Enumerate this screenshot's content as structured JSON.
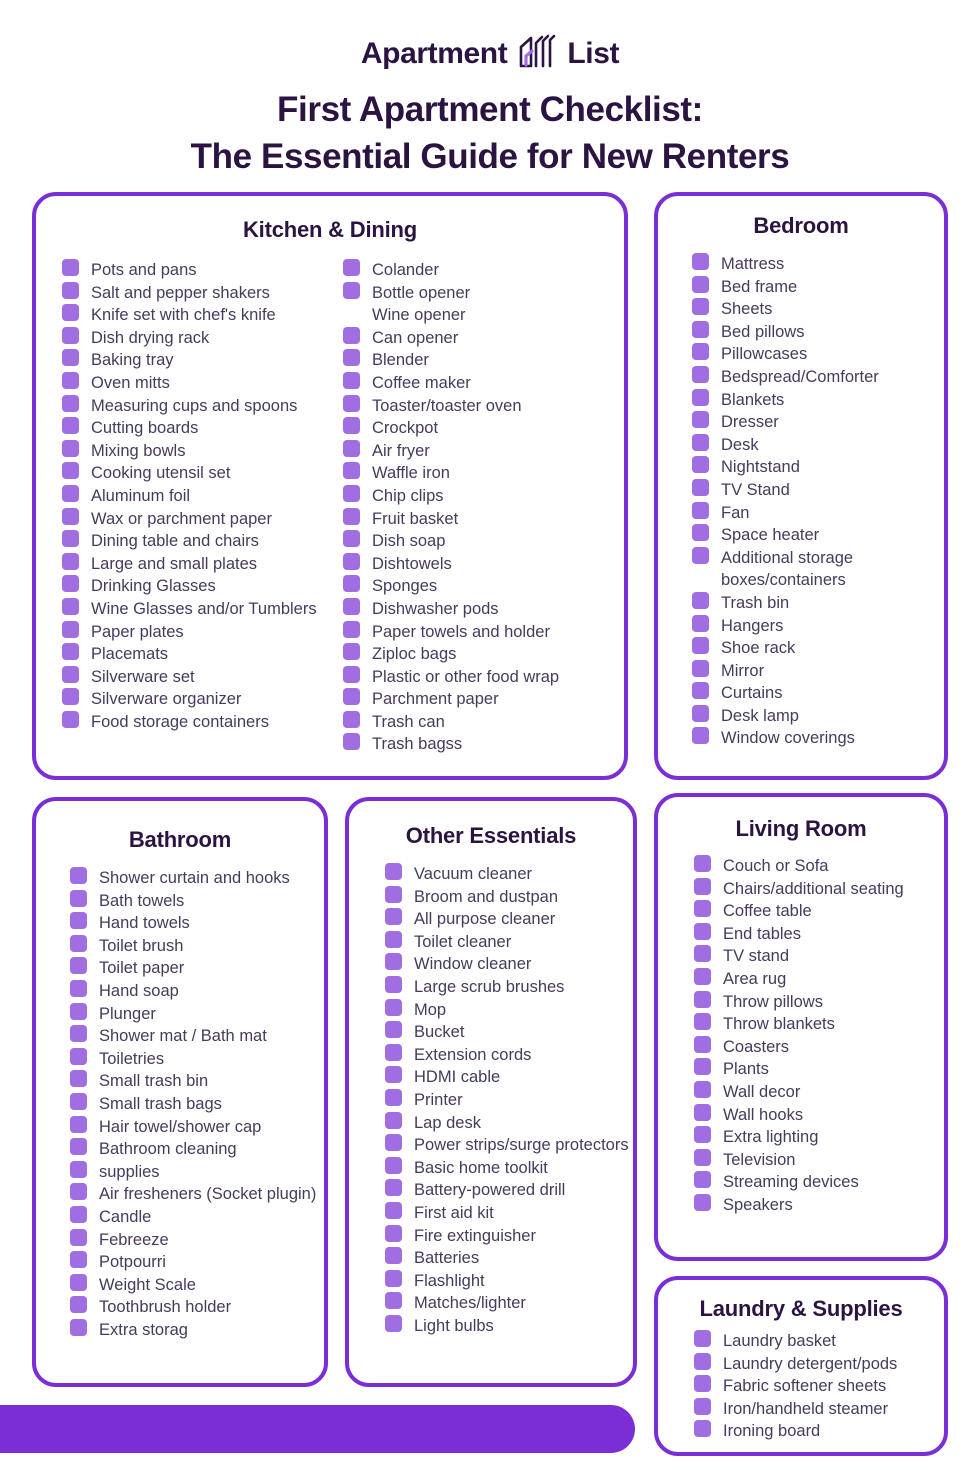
{
  "brand": {
    "name_left": "Apartment",
    "name_right": "List",
    "logo_icon": "apartment-list-house-icon"
  },
  "title": {
    "line1": "First Apartment Checklist:",
    "line2": "The Essential Guide for New Renters"
  },
  "colors": {
    "border": "#7c2ed6",
    "checkbox": "#a06ee0",
    "heading": "#2b1442",
    "item_text": "#473a5c",
    "bar": "#7c2ed6"
  },
  "cards": {
    "kitchen": {
      "title": "Kitchen & Dining",
      "col1": [
        "Pots and pans",
        "Salt and pepper shakers",
        "Knife set with chef's knife",
        "Dish drying rack",
        "Baking tray",
        "Oven mitts",
        "Measuring cups and spoons",
        "Cutting boards",
        "Mixing bowls",
        "Cooking utensil set",
        "Aluminum foil",
        "Wax or parchment paper",
        "Dining table and chairs",
        "Large and small plates",
        "Drinking Glasses",
        "Wine Glasses and/or Tumblers",
        "Paper plates",
        "Placemats",
        "Silverware set",
        "Silverware organizer",
        "Food storage containers"
      ],
      "col2": [
        "Colander",
        "Bottle opener",
        "Wine opener",
        "Can opener",
        "Blender",
        "Coffee maker",
        "Toaster/toaster oven",
        "Crockpot",
        "Air fryer",
        "Waffle iron",
        "Chip clips",
        "Fruit basket",
        "Dish soap",
        "Dishtowels",
        "Sponges",
        "Dishwasher pods",
        "Paper towels and holder",
        "Ziploc bags",
        "Plastic or other food wrap",
        "Parchment paper",
        "Trash can",
        "Trash bagss"
      ],
      "col2_no_checkbox_indexes": [
        2
      ]
    },
    "bedroom": {
      "title": "Bedroom",
      "items": [
        "Mattress",
        "Bed frame",
        "Sheets",
        "Bed pillows",
        "Pillowcases",
        "Bedspread/Comforter",
        "Blankets",
        "Dresser",
        "Desk",
        "Nightstand",
        "TV Stand",
        "Fan",
        "Space heater",
        "Additional storage boxes/containers",
        "Trash bin",
        "Hangers",
        "Shoe rack",
        "Mirror",
        "Curtains",
        "Desk lamp",
        "Window coverings"
      ]
    },
    "bathroom": {
      "title": "Bathroom",
      "items": [
        "Shower curtain and hooks",
        "Bath towels",
        "Hand towels",
        "Toilet brush",
        "Toilet paper",
        "Hand soap",
        "Plunger",
        "Shower mat / Bath mat",
        "Toiletries",
        "Small trash bin",
        "Small trash bags",
        "Hair towel/shower cap",
        "Bathroom cleaning",
        "supplies",
        "Air fresheners (Socket plugin)",
        "Candle",
        "Febreeze",
        "Potpourri",
        "Weight Scale",
        "Toothbrush holder",
        "Extra storag"
      ]
    },
    "other": {
      "title": "Other Essentials",
      "items": [
        "Vacuum cleaner",
        "Broom and dustpan",
        "All purpose cleaner",
        "Toilet cleaner",
        "Window cleaner",
        "Large scrub brushes",
        "Mop",
        "Bucket",
        "Extension cords",
        "HDMI cable",
        "Printer",
        "Lap desk",
        "Power strips/surge protectors",
        "Basic home toolkit",
        "Battery-powered drill",
        "First aid kit",
        "Fire extinguisher",
        "Batteries",
        "Flashlight",
        "Matches/lighter",
        "Light bulbs"
      ]
    },
    "living": {
      "title": "Living Room",
      "items": [
        "Couch or Sofa",
        "Chairs/additional seating",
        "Coffee table",
        "End tables",
        "TV stand",
        "Area rug",
        "Throw pillows",
        "Throw blankets",
        "Coasters",
        "Plants",
        "Wall decor",
        "Wall hooks",
        "Extra lighting",
        "Television",
        "Streaming devices",
        "Speakers"
      ]
    },
    "laundry": {
      "title": "Laundry & Supplies",
      "items": [
        "Laundry basket",
        "Laundry detergent/pods",
        "Fabric softener sheets",
        "Iron/handheld steamer",
        "Ironing board"
      ]
    }
  }
}
